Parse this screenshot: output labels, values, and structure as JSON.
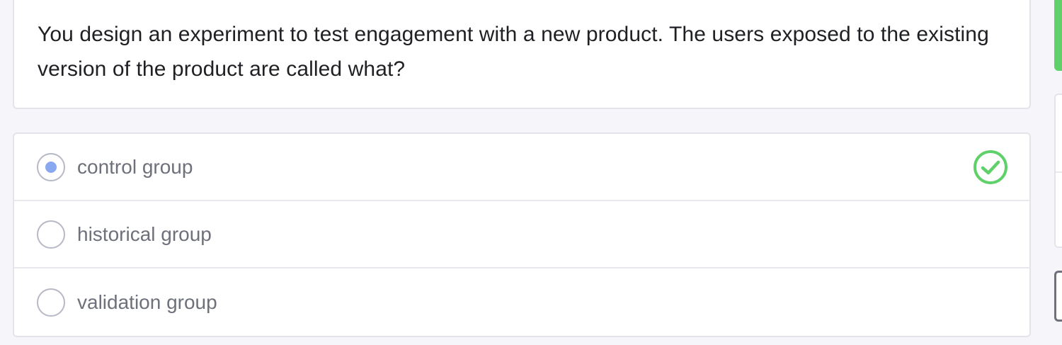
{
  "question": {
    "text": "You design an experiment to test engagement with a new product. The users exposed to the existing version of the product are called what?"
  },
  "options": [
    {
      "label": "control group",
      "selected": true,
      "status_icon": "check-circle-icon"
    },
    {
      "label": "historical group",
      "selected": false
    },
    {
      "label": "validation group",
      "selected": false
    }
  ],
  "colors": {
    "correct": "#5fd06a",
    "radio_selected": "#8aa8ef",
    "text_primary": "#1f2024",
    "text_option": "#6e717b"
  }
}
